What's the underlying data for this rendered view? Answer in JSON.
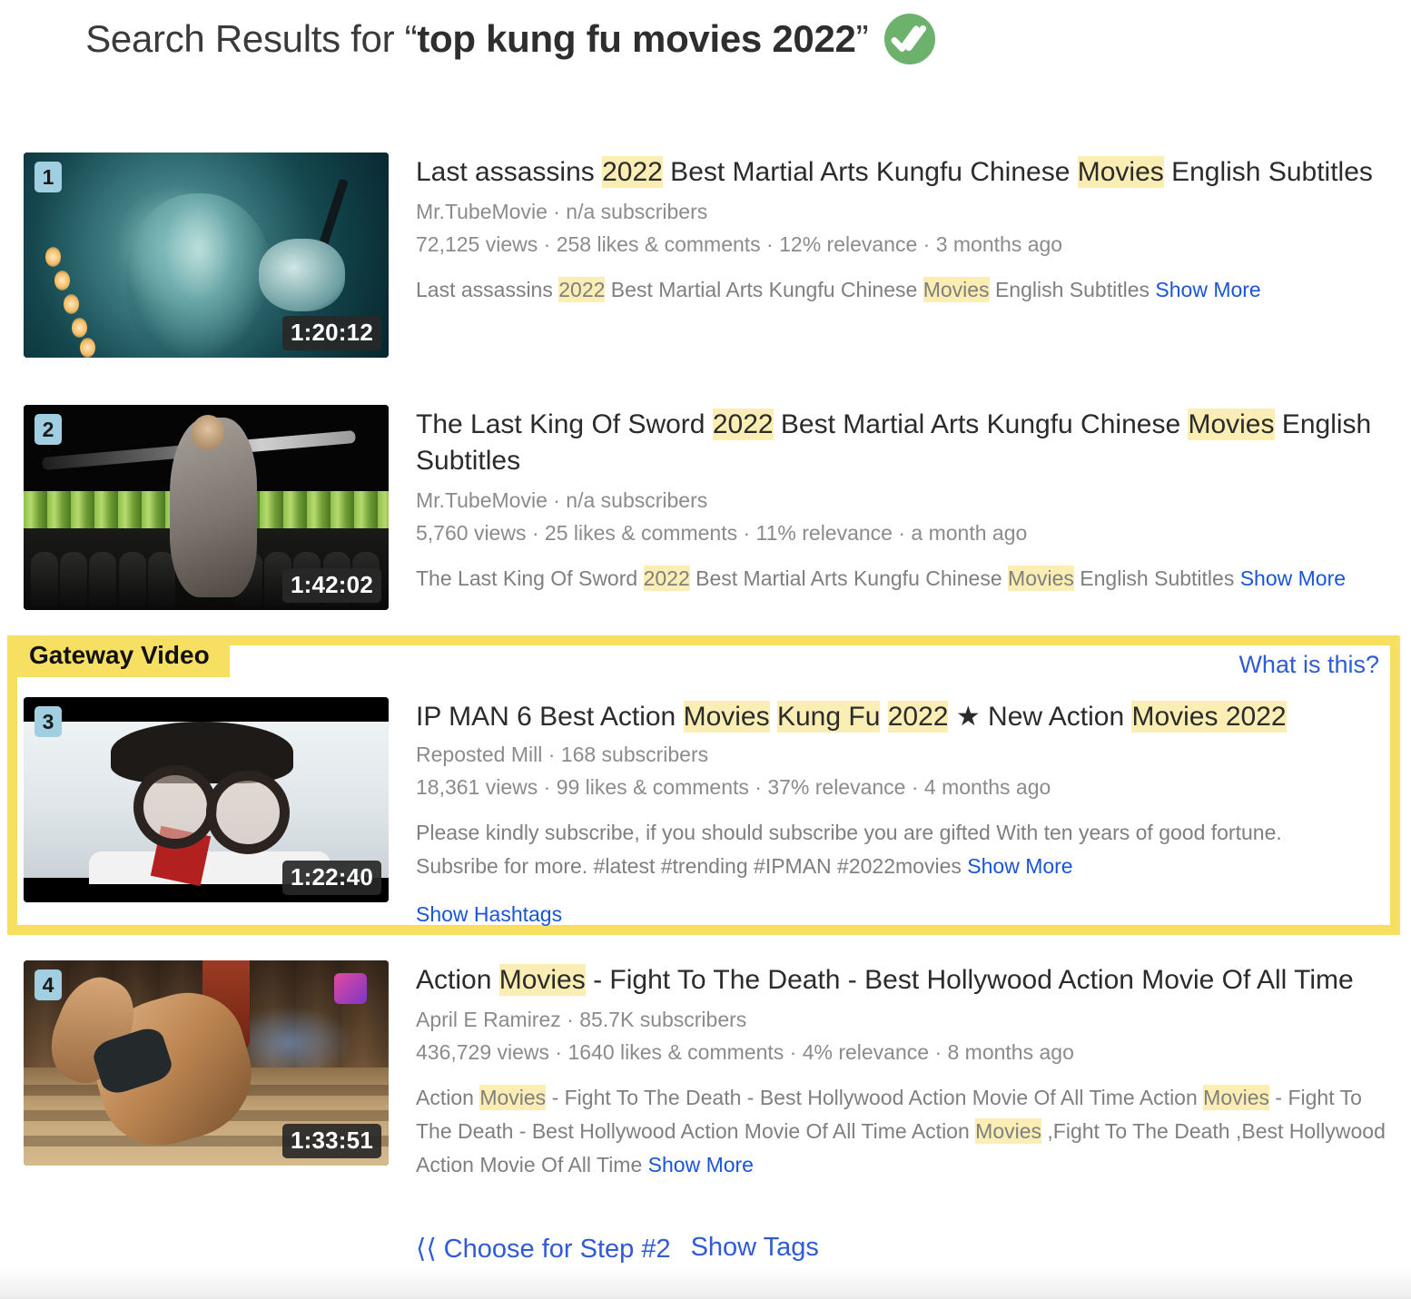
{
  "header": {
    "prefix": "Search Results for “",
    "query": "top kung fu movies 2022",
    "suffix": "”",
    "verified_icon": "double-check-icon",
    "verified_color": "#6cb26c"
  },
  "colors": {
    "highlight": "#faeeb4",
    "link": "#1a54d8",
    "gateway_border": "#f7df62",
    "number_badge": "#9fcfe0"
  },
  "results": [
    {
      "number": "1",
      "duration": "1:20:12",
      "title_parts": [
        {
          "t": "Last assassins ",
          "h": false
        },
        {
          "t": "2022",
          "h": true
        },
        {
          "t": " Best Martial Arts Kungfu Chinese ",
          "h": false
        },
        {
          "t": "Movies",
          "h": true
        },
        {
          "t": " English Subtitles",
          "h": false
        }
      ],
      "channel_line": "Mr.TubeMovie · n/a subscribers",
      "stats_line": "72,125 views · 258 likes & comments · 12% relevance · 3 months ago",
      "desc_parts": [
        {
          "t": "Last assassins ",
          "h": false
        },
        {
          "t": "2022",
          "h": true
        },
        {
          "t": " Best Martial Arts Kungfu Chinese ",
          "h": false
        },
        {
          "t": "Movies",
          "h": true
        },
        {
          "t": " English Subtitles ",
          "h": false
        }
      ],
      "show_more": "Show More"
    },
    {
      "number": "2",
      "duration": "1:42:02",
      "title_parts": [
        {
          "t": "The Last King Of Sword ",
          "h": false
        },
        {
          "t": "2022",
          "h": true
        },
        {
          "t": " Best Martial Arts Kungfu Chinese ",
          "h": false
        },
        {
          "t": "Movies",
          "h": true
        },
        {
          "t": " English Subtitles",
          "h": false
        }
      ],
      "channel_line": "Mr.TubeMovie · n/a subscribers",
      "stats_line": "5,760 views · 25 likes & comments · 11% relevance · a month ago",
      "desc_parts": [
        {
          "t": "The Last King Of Sword ",
          "h": false
        },
        {
          "t": "2022",
          "h": true
        },
        {
          "t": " Best Martial Arts Kungfu Chinese ",
          "h": false
        },
        {
          "t": "Movies",
          "h": true
        },
        {
          "t": " English Subtitles ",
          "h": false
        }
      ],
      "show_more": "Show More"
    },
    {
      "number": "3",
      "duration": "1:22:40",
      "title_parts": [
        {
          "t": "IP MAN 6 Best Action ",
          "h": false
        },
        {
          "t": "Movies",
          "h": true
        },
        {
          "t": " ",
          "h": false
        },
        {
          "t": "Kung Fu",
          "h": true
        },
        {
          "t": " ",
          "h": false
        },
        {
          "t": "2022",
          "h": true
        },
        {
          "t": " ★ New Action ",
          "h": false
        },
        {
          "t": "Movies 2022",
          "h": true
        }
      ],
      "channel_line": "Reposted Mill · 168 subscribers",
      "stats_line": "18,361 views · 99 likes & comments · 37% relevance · 4 months ago",
      "desc_parts": [
        {
          "t": "Please kindly subscribe, if you should subscribe you are gifted With ten years of good fortune. Subsribe for more. #latest #trending #IPMAN #2022movies ",
          "h": false
        }
      ],
      "show_more": "Show More",
      "show_hashtags": "Show Hashtags"
    },
    {
      "number": "4",
      "duration": "1:33:51",
      "title_parts": [
        {
          "t": "Action ",
          "h": false
        },
        {
          "t": "Movies",
          "h": true
        },
        {
          "t": " - Fight To The Death - Best Hollywood Action Movie Of All Time",
          "h": false
        }
      ],
      "channel_line": "April E Ramirez · 85.7K subscribers",
      "stats_line": "436,729 views · 1640 likes & comments · 4% relevance · 8 months ago",
      "desc_parts": [
        {
          "t": "Action ",
          "h": false
        },
        {
          "t": "Movies",
          "h": true
        },
        {
          "t": " - Fight To The Death - Best Hollywood Action Movie Of All Time Action ",
          "h": false
        },
        {
          "t": "Movies",
          "h": true
        },
        {
          "t": " - Fight To The Death - Best Hollywood Action Movie Of All Time Action ",
          "h": false
        },
        {
          "t": "Movies",
          "h": true
        },
        {
          "t": " ,Fight To The Death ,Best Hollywood Action Movie Of All Time ",
          "h": false
        }
      ],
      "show_more": "Show More"
    }
  ],
  "gateway": {
    "label": "Gateway Video",
    "what_is_this": "What is this?"
  },
  "footer": {
    "choose_step": "⟨⟨ Choose for Step #2",
    "show_tags": "Show Tags"
  }
}
